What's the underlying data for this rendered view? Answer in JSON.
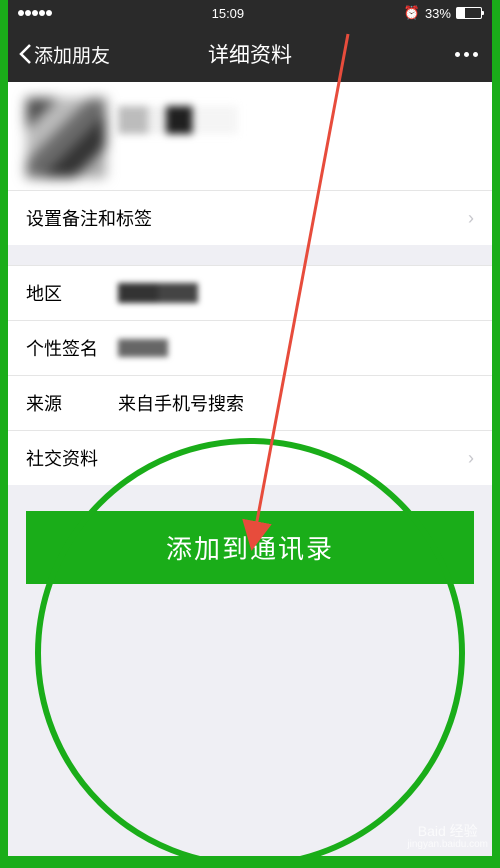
{
  "status": {
    "time": "15:09",
    "battery_pct": "33%"
  },
  "nav": {
    "back": "添加朋友",
    "title": "详细资料"
  },
  "cells": {
    "set_remark": "设置备注和标签",
    "region_label": "地区",
    "signature_label": "个性签名",
    "source_label": "来源",
    "source_value": "来自手机号搜索",
    "social_label": "社交资料"
  },
  "button": {
    "add_label": "添加到通讯录"
  },
  "watermark": {
    "line1": "Baid 经验",
    "line2": "jingyan.baidu.com"
  }
}
